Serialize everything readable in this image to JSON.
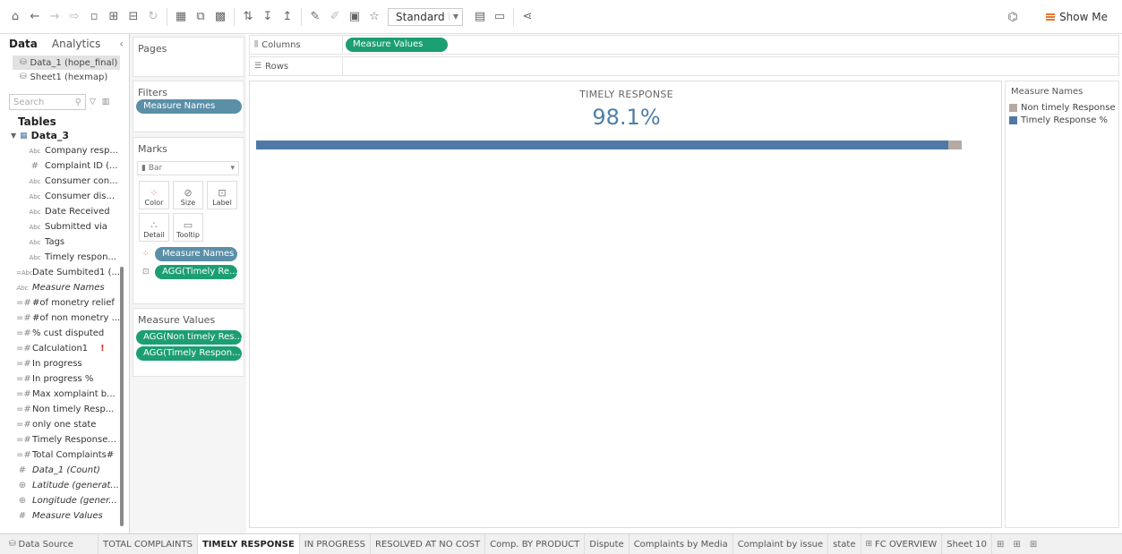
{
  "toolbar": {
    "view_mode": "Standard",
    "show_me_label": "Show Me"
  },
  "data_pane": {
    "tab_data": "Data",
    "tab_analytics": "Analytics",
    "sources": [
      {
        "label": "Data_1 (hope_final)"
      },
      {
        "label": "Sheet1 (hexmap)"
      }
    ],
    "search_placeholder": "Search",
    "tables_header": "Tables",
    "table_name": "Data_3",
    "fields": [
      {
        "type": "Abc",
        "label": "Company resp..."
      },
      {
        "type": "#",
        "label": "Complaint ID (..."
      },
      {
        "type": "Abc",
        "label": "Consumer con..."
      },
      {
        "type": "Abc",
        "label": "Consumer dis..."
      },
      {
        "type": "Abc",
        "label": "Date Received"
      },
      {
        "type": "Abc",
        "label": "Submitted via"
      },
      {
        "type": "Abc",
        "label": "Tags"
      },
      {
        "type": "Abc",
        "label": "Timely respon..."
      }
    ],
    "calc_fields": [
      {
        "type": "=Abc",
        "label": "Date Sumbited1 (...",
        "italic": false
      },
      {
        "type": "Abc",
        "label": "Measure Names",
        "italic": true
      },
      {
        "type": "=#",
        "label": "#of monetry relief",
        "italic": false
      },
      {
        "type": "=#",
        "label": "#of non monetry ...",
        "italic": false
      },
      {
        "type": "=#",
        "label": "% cust disputed",
        "italic": false
      },
      {
        "type": "=#",
        "label": "Calculation1",
        "italic": false,
        "error": "!"
      },
      {
        "type": "=#",
        "label": "In progress",
        "italic": false
      },
      {
        "type": "=#",
        "label": "In progress %",
        "italic": false
      },
      {
        "type": "=#",
        "label": "Max xomplaint b...",
        "italic": false
      },
      {
        "type": "=#",
        "label": "Non timely Resp...",
        "italic": false
      },
      {
        "type": "=#",
        "label": "only one state",
        "italic": false
      },
      {
        "type": "=#",
        "label": "Timely Response...",
        "italic": false
      },
      {
        "type": "=#",
        "label": "Total Complaints#",
        "italic": false
      },
      {
        "type": "#",
        "label": "Data_1 (Count)",
        "italic": true
      },
      {
        "type": "⊕",
        "label": "Latitude (generat...",
        "italic": true
      },
      {
        "type": "⊕",
        "label": "Longitude (gener...",
        "italic": true
      },
      {
        "type": "#",
        "label": "Measure Values",
        "italic": true
      }
    ]
  },
  "cards": {
    "pages_title": "Pages",
    "filters_title": "Filters",
    "filter_pill": "Measure Names",
    "marks_title": "Marks",
    "mark_type": "Bar",
    "mark_buttons": [
      {
        "label": "Color"
      },
      {
        "label": "Size"
      },
      {
        "label": "Label"
      },
      {
        "label": "Detail"
      },
      {
        "label": "Tooltip"
      }
    ],
    "marks_pill_color": "Measure Names",
    "marks_pill_label": "AGG(Timely Re...",
    "measure_values_title": "Measure Values",
    "measure_values_pills": [
      {
        "label": "AGG(Non timely Res..."
      },
      {
        "label": "AGG(Timely Respon..."
      }
    ]
  },
  "shelves": {
    "columns_label": "Columns",
    "columns_pill": "Measure Values",
    "rows_label": "Rows"
  },
  "viz": {
    "title": "TIMELY RESPONSE",
    "value": "98.1%"
  },
  "legend": {
    "title": "Measure Names",
    "items": [
      {
        "label": "Non timely Response",
        "color": "#b5aaa3"
      },
      {
        "label": "Timely Response %",
        "color": "#4e79a7"
      }
    ]
  },
  "chart_data": {
    "type": "bar",
    "orientation": "horizontal",
    "stacked": true,
    "title": "TIMELY RESPONSE",
    "series": [
      {
        "name": "Timely Response %",
        "value": 98.1,
        "color": "#4e79a7"
      },
      {
        "name": "Non timely Response",
        "value": 1.9,
        "color": "#b5aaa3"
      }
    ],
    "xlim": [
      0,
      100
    ],
    "legend": "right"
  },
  "sheet_tabs": {
    "data_source": "Data Source",
    "tabs": [
      {
        "label": "TOTAL COMPLAINTS",
        "active": false
      },
      {
        "label": "TIMELY RESPONSE",
        "active": true
      },
      {
        "label": "IN PROGRESS",
        "active": false
      },
      {
        "label": "RESOLVED AT NO COST",
        "active": false
      },
      {
        "label": "Comp. BY PRODUCT",
        "active": false
      },
      {
        "label": "Dispute",
        "active": false
      },
      {
        "label": "Complaints by Media",
        "active": false
      },
      {
        "label": "Complaint by issue",
        "active": false
      },
      {
        "label": "state",
        "active": false
      },
      {
        "label": "FC OVERVIEW",
        "active": false
      },
      {
        "label": "Sheet 10",
        "active": false
      }
    ]
  }
}
